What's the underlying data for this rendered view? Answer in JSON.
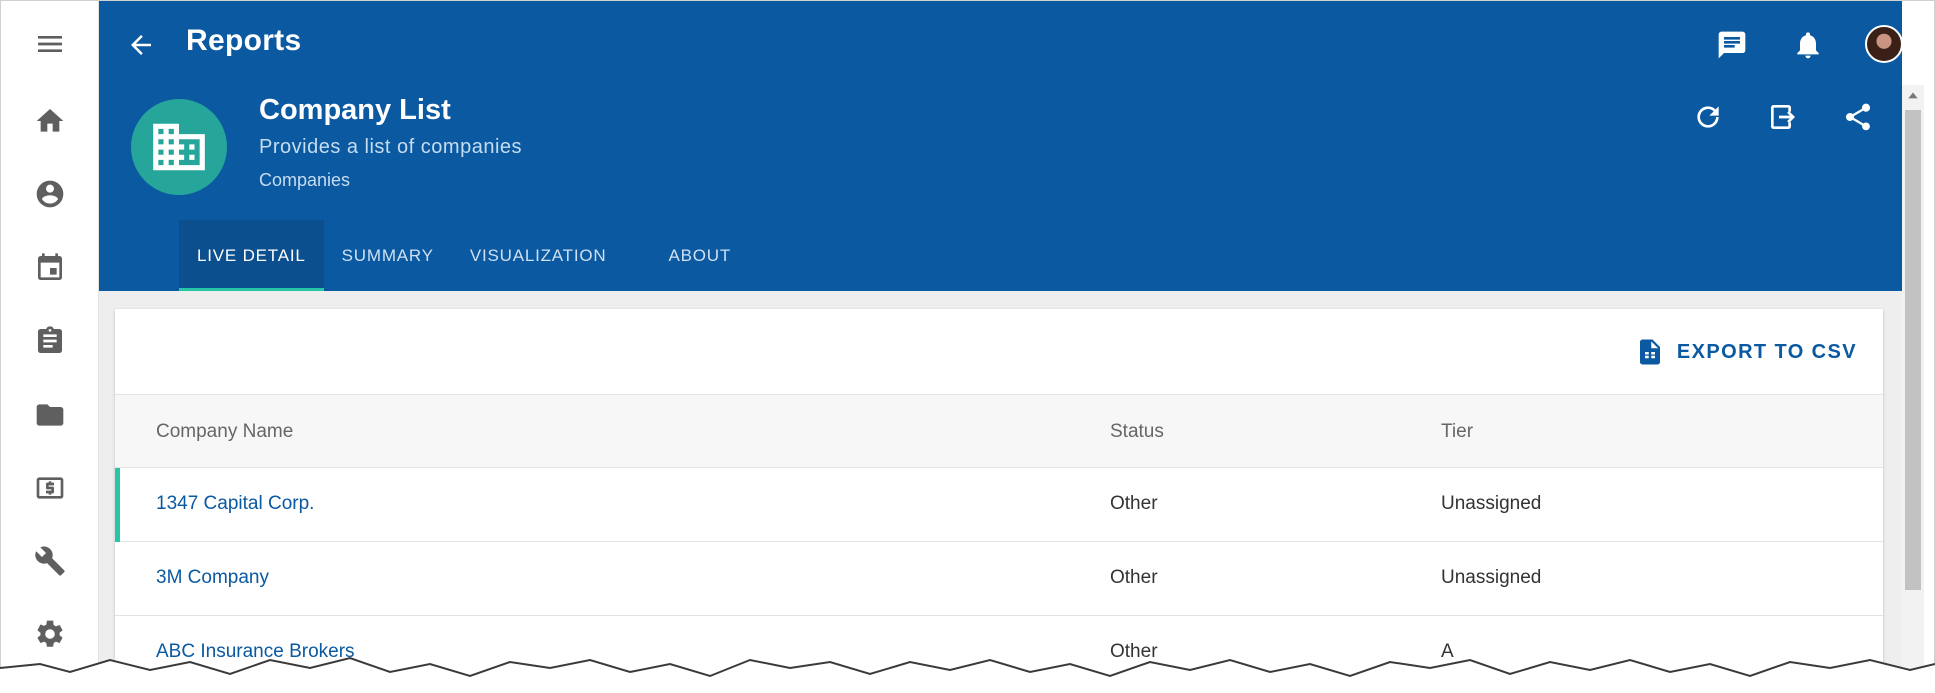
{
  "topbar": {
    "title": "Reports"
  },
  "rail": {
    "items": [
      "menu-icon",
      "home-icon",
      "account-icon",
      "calendar-icon",
      "clipboard-icon",
      "folder-icon",
      "money-icon",
      "wrench-icon",
      "gear-icon"
    ]
  },
  "report": {
    "title": "Company List",
    "subtitle": "Provides a list of companies",
    "category": "Companies"
  },
  "tabs": [
    {
      "label": "LIVE DETAIL",
      "active": true
    },
    {
      "label": "SUMMARY",
      "active": false
    },
    {
      "label": "VISUALIZATION",
      "active": false
    },
    {
      "label": "ABOUT",
      "active": false
    }
  ],
  "toolbar": {
    "export_label": "EXPORT TO CSV"
  },
  "table": {
    "columns": [
      "Company Name",
      "Status",
      "Tier"
    ],
    "rows": [
      {
        "name": "1347 Capital Corp.",
        "status": "Other",
        "tier": "Unassigned"
      },
      {
        "name": "3M Company",
        "status": "Other",
        "tier": "Unassigned"
      },
      {
        "name": "ABC Insurance Brokers",
        "status": "Other",
        "tier": "A"
      }
    ]
  },
  "colors": {
    "header": "#0a59a1",
    "accent": "#26c6a6",
    "report_icon_bg": "#26a69a"
  }
}
